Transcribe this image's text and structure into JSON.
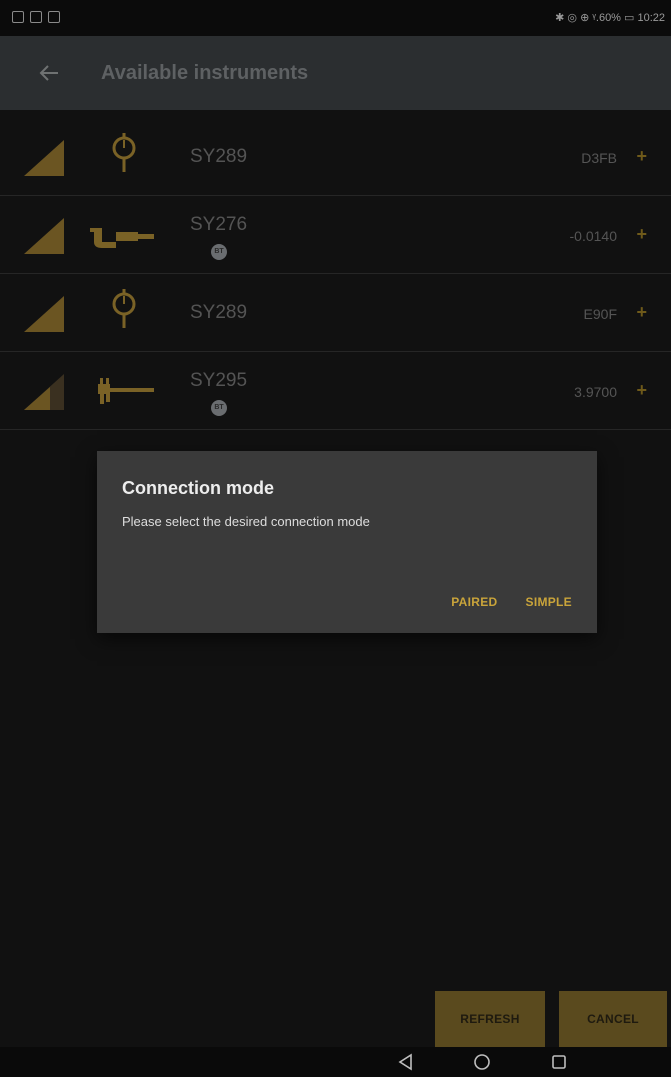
{
  "status_bar": {
    "left_icons": [
      "signal-icon",
      "play-icon",
      "notification-icon"
    ],
    "right_text": "✱ ◎ ⊕ ᵞ.60% ▭ 10:22"
  },
  "app_bar": {
    "title": "Available instruments",
    "back_icon": "arrow-left-icon"
  },
  "instruments": [
    {
      "name": "SY289",
      "value": "D3FB",
      "icon": "dial-indicator-icon",
      "badge": false,
      "signal": "full"
    },
    {
      "name": "SY276",
      "value": "-0.0140",
      "icon": "micrometer-icon",
      "badge": true,
      "signal": "full"
    },
    {
      "name": "SY289",
      "value": "E90F",
      "icon": "dial-indicator-icon",
      "badge": false,
      "signal": "full"
    },
    {
      "name": "SY295",
      "value": "3.9700",
      "icon": "caliper-icon",
      "badge": true,
      "signal": "medium"
    }
  ],
  "add_label": "+",
  "dialog": {
    "title": "Connection mode",
    "message": "Please select the desired connection mode",
    "buttons": {
      "paired": "PAIRED",
      "simple": "SIMPLE"
    }
  },
  "footer": {
    "refresh": "REFRESH",
    "cancel": "CANCEL"
  },
  "colors": {
    "accent": "#c9a43a",
    "signal_full": "#6b5522",
    "signal_dim": "#3a3020",
    "app_bar_bg": "#2b2e30",
    "dialog_bg": "#3a3a3a"
  }
}
